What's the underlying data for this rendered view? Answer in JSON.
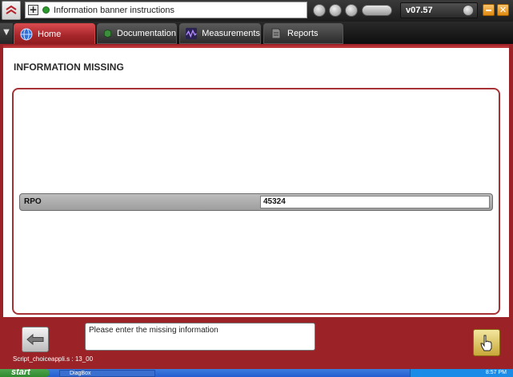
{
  "header": {
    "banner_text": "Information banner instructions",
    "version": "v07.57"
  },
  "tabs": [
    {
      "label": "Home",
      "icon": "globe-icon"
    },
    {
      "label": "Documentation",
      "icon": "book-icon"
    },
    {
      "label": "Measurements",
      "icon": "waveform-icon"
    },
    {
      "label": "Reports",
      "icon": "document-icon"
    }
  ],
  "main": {
    "title": "INFORMATION MISSING",
    "field_label": "RPO",
    "field_value": "45324"
  },
  "footer": {
    "message": "Please enter the missing information",
    "script_label": "Script_choiceappli.s : 13_00"
  },
  "taskbar": {
    "start_label": "start",
    "task_item": "DiagBox",
    "clock": "8:57 PM"
  },
  "colors": {
    "brand_red": "#9b2226",
    "active_tab": "#b93236"
  }
}
